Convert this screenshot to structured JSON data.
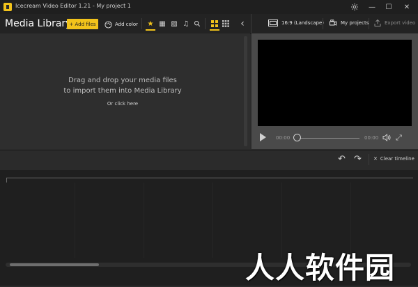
{
  "window": {
    "title": "Icecream Video Editor 1.21 - My project 1",
    "settings_icon": "gear-icon",
    "minimize_symbol": "—",
    "maximize_symbol": "☐",
    "close_symbol": "✕"
  },
  "toolbar": {
    "media_library_title": "Media Library",
    "add_files_label": "+ Add files",
    "add_color_label": "Add color",
    "filters": [
      {
        "name": "all",
        "icon": "star-icon",
        "glyph": "★",
        "active": true
      },
      {
        "name": "video",
        "icon": "film-icon",
        "glyph": "▦",
        "active": false
      },
      {
        "name": "image",
        "icon": "image-icon",
        "glyph": "▨",
        "active": false
      },
      {
        "name": "audio",
        "icon": "music-note-icon",
        "glyph": "♫",
        "active": false
      },
      {
        "name": "search",
        "icon": "search-icon",
        "glyph": "⌕",
        "active": false
      }
    ],
    "views": [
      {
        "name": "large-grid",
        "icon": "grid-large-icon",
        "glyph": "▣",
        "active": true
      },
      {
        "name": "small-grid",
        "icon": "grid-small-icon",
        "glyph": "▦",
        "active": false
      }
    ],
    "collapse_symbol": "‹",
    "aspect_ratio_label": "16:9 (Landscape)",
    "my_projects_label": "My projects",
    "export_video_label": "Export video"
  },
  "library": {
    "drop_line1": "Drag and drop your media files",
    "drop_line2": "to import them into Media Library",
    "click_here": "Or click here"
  },
  "player": {
    "time_start": "00:00",
    "time_end": "00:00",
    "progress": 0,
    "volume_symbol": "🔊",
    "fullscreen_symbol": "⤢"
  },
  "timeline": {
    "undo_symbol": "↶",
    "redo_symbol": "↷",
    "clear_label": "Clear timeline",
    "clear_symbol": "✕"
  },
  "watermark": {
    "text": "人人软件园"
  },
  "colors": {
    "accent": "#f2c31b",
    "background": "#2b2b2b",
    "preview_panel": "#4a4a4a",
    "timeline": "#1f1f1f"
  }
}
